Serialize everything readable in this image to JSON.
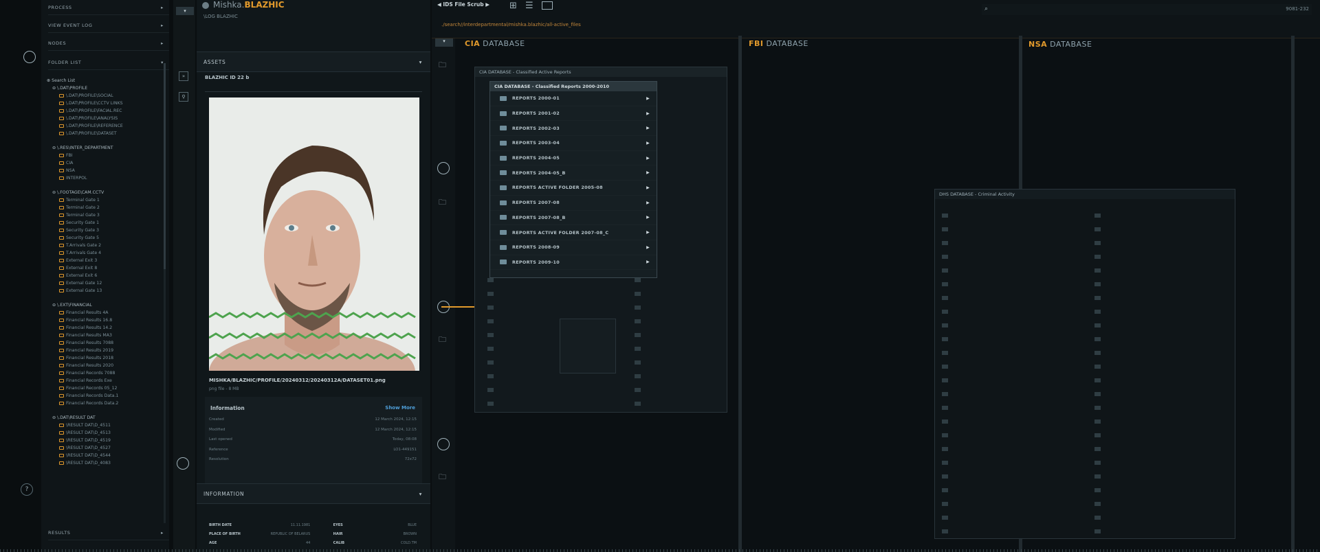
{
  "left_nav": {
    "rows": [
      "PROCESS",
      "VIEW EVENT LOG",
      "NODES",
      "FOLDER LIST"
    ],
    "results_label": "RESULTS",
    "tree": {
      "search_label": "Search List",
      "groups": [
        {
          "name": "\\.DAT\\PROFILE",
          "items": [
            "\\.DAT\\PROFILE\\SOCIAL",
            "\\.DAT\\PROFILE\\CCTV LINKS",
            "\\.DAT\\PROFILE\\FACIAL.REC",
            "\\.DAT\\PROFILE\\ANALYSIS",
            "\\.DAT\\PROFILE\\REFERENCE",
            "\\.DAT\\PROFILE\\DATASET"
          ]
        },
        {
          "name": "\\.RES\\INTER_DEPARTMENT",
          "items": [
            "FBI",
            "CIA",
            "NSA",
            "INTERPOL"
          ]
        },
        {
          "name": "\\.FOOTAGE\\CAM.CCTV",
          "items": [
            "Terminal Gate 1",
            "Terminal Gate 2",
            "Terminal Gate 3",
            "Security Gate 1",
            "Security Gate 3",
            "Security Gate 5",
            "T.Arrivals Gate 2",
            "T.Arrivals Gate 4",
            "External Exit 3",
            "External Exit 8",
            "External Exit 6",
            "External Gate 12",
            "External Gate 13"
          ]
        },
        {
          "name": "\\.EXT\\FINANCIAL",
          "items": [
            "Financial Results 4A",
            "Financial Results 16.8",
            "Financial Results 14.2",
            "Financial Results MA3",
            "Financial Results 7088",
            "Financial Results 2019",
            "Financial Results 2018",
            "Financial Results 2020",
            "Financial Records 7088",
            "Financial Records Exe",
            "Financial Records 05_12",
            "Financial Records Data.1",
            "Financial Records Data.2"
          ]
        },
        {
          "name": "\\.DAT\\RESULT DAT",
          "items": [
            "\\RESULT DAT\\D_4511",
            "\\RESULT DAT\\D_4513",
            "\\RESULT DAT\\D_4519",
            "\\RESULT DAT\\D_4527",
            "\\RESULT DAT\\D_4544",
            "\\RESULT DAT\\D_4083"
          ]
        }
      ]
    }
  },
  "profile": {
    "first_name": "Mishka.",
    "last_name": "BLAZHIC",
    "log_path": "\\LOG BLAZHIC",
    "assets_label": "ASSETS",
    "asset_id": "BLAZHIC ID 22 b",
    "file_path": "MISHKA/BLAZHIC/PROFILE/20240312/20240312A/DATASET01.png",
    "file_meta": "png file - 8 MB",
    "info_heading": "Information",
    "show_more": "Show More",
    "info_rows": [
      {
        "k": "Created",
        "v": "12 March 2024, 12:15"
      },
      {
        "k": "Modified",
        "v": "12 March 2024, 12:15"
      },
      {
        "k": "Last opened",
        "v": "Today, 08:08"
      },
      {
        "k": "Reference",
        "v": "LO1-449151"
      },
      {
        "k": "Resolution",
        "v": "72x72"
      }
    ],
    "information_label": "INFORMATION",
    "details": [
      {
        "k1": "BIRTH DATE",
        "v1": "11.11.1981",
        "k2": "EYES",
        "v2": "BLUE"
      },
      {
        "k1": "PLACE OF BIRTH",
        "v1": "REPUBLIC OF BELARUS",
        "k2": "HAIR",
        "v2": "BROWN"
      },
      {
        "k1": "AGE",
        "v1": "44",
        "k2": "CALIB",
        "v2": "COLD.TM"
      }
    ]
  },
  "toolbar": {
    "title": "IDS File Scrub",
    "path": "./search//interdepartmental/mishka.blazhic/all-active_files",
    "counter": "9081-232"
  },
  "databases": [
    {
      "prefix": "CIA",
      "suffix": " DATABASE"
    },
    {
      "prefix": "FBI",
      "suffix": " DATABASE"
    },
    {
      "prefix": "NSA",
      "suffix": " DATABASE"
    }
  ],
  "cia_window": {
    "outer_title": "CIA DATABASE - Classified Active Reports",
    "inner_title": "CIA DATABASE - Classified Reports 2000-2010",
    "reports": [
      "REPORTS 2000-01",
      "REPORTS 2001-02",
      "REPORTS 2002-03",
      "REPORTS 2003-04",
      "REPORTS 2004-05",
      "REPORTS 2004-05_B",
      "REPORTS ACTIVE FOLDER 2005-08",
      "REPORTS 2007-08",
      "REPORTS 2007-08_B",
      "REPORTS ACTIVE FOLDER 2007-08_C",
      "REPORTS 2008-09",
      "REPORTS 2009-10"
    ]
  },
  "dhs_window": {
    "title": "DHS DATABASE - Criminal Activity"
  },
  "colors": {
    "accent": "#e29a2c",
    "bg": "#0a0e10",
    "panel": "#141b1f"
  }
}
